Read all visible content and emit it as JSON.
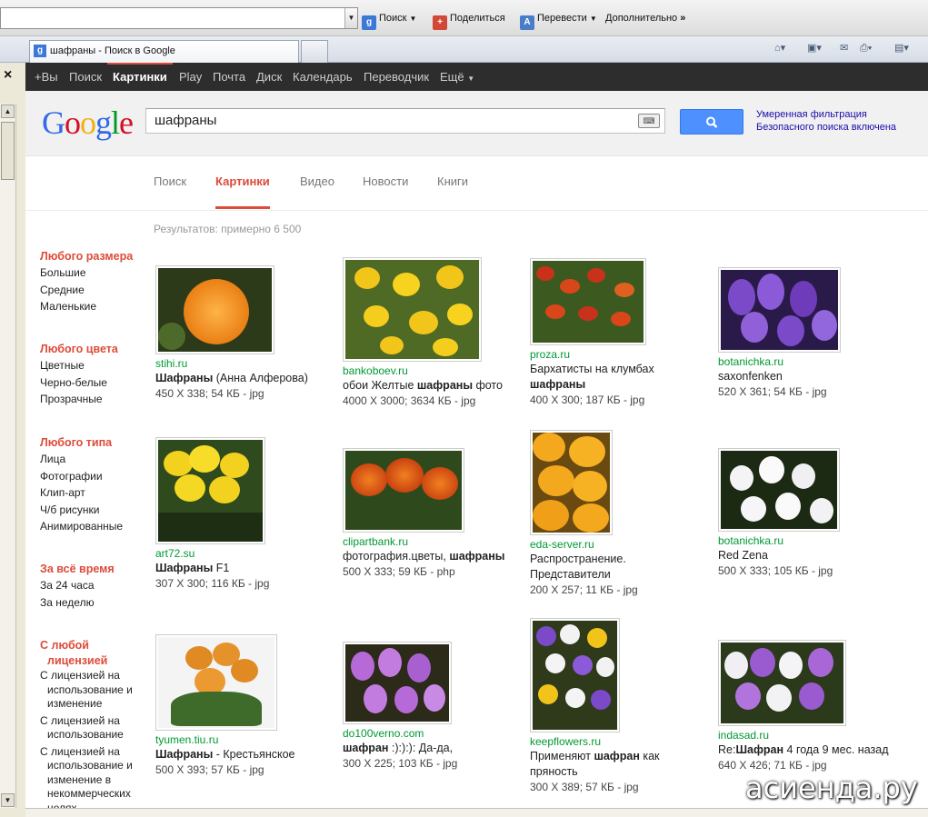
{
  "browser": {
    "toolbar": {
      "search_label": "Поиск",
      "share_label": "Поделиться",
      "translate_label": "Перевести",
      "more_label": "Дополнительно"
    },
    "tab_title": "шафраны - Поиск в Google"
  },
  "gbar": {
    "items": [
      "+Вы",
      "Поиск",
      "Картинки",
      "Play",
      "Почта",
      "Диск",
      "Календарь",
      "Переводчик",
      "Ещё"
    ]
  },
  "header": {
    "logo": [
      "G",
      "o",
      "o",
      "g",
      "l",
      "e"
    ],
    "query": "шафраны",
    "safe_line1": "Умеренная фильтрация",
    "safe_line2": "Безопасного поиска включена"
  },
  "tabs": [
    "Поиск",
    "Картинки",
    "Видео",
    "Новости",
    "Книги"
  ],
  "results_count": "Результатов: примерно 6 500",
  "filters": {
    "size": {
      "title": "Любого размера",
      "items": [
        "Большие",
        "Средние",
        "Маленькие"
      ]
    },
    "color": {
      "title": "Любого цвета",
      "items": [
        "Цветные",
        "Черно-белые",
        "Прозрачные"
      ]
    },
    "type": {
      "title": "Любого типа",
      "items": [
        "Лица",
        "Фотографии",
        "Клип-арт",
        "Ч/б рисунки",
        "Анимированные"
      ]
    },
    "time": {
      "title": "За всё время",
      "items": [
        "За 24 часа",
        "За неделю"
      ]
    },
    "license": {
      "title": "С любой лицензией",
      "items": [
        "С лицензией на использование и изменение",
        "С лицензией на использование",
        "С лицензией на использование и изменение в некоммерческих целях"
      ]
    }
  },
  "results": [
    {
      "domain": "stihi.ru",
      "title_bold": "Шафраны",
      "title_rest": " (Анна Алферова)",
      "meta": "450 X 338; 54 КБ - jpg"
    },
    {
      "domain": "bankoboev.ru",
      "title_pre": "обои Желтые ",
      "title_bold": "шафраны",
      "title_rest": " фото",
      "meta": "4000 X 3000; 3634 КБ - jpg"
    },
    {
      "domain": "proza.ru",
      "title_pre": "Бархатисты на клумбах ",
      "title_bold": "шафраны",
      "title_rest": "",
      "meta": "400 X 300; 187 КБ - jpg"
    },
    {
      "domain": "botanichka.ru",
      "title_pre": "saxonfenken",
      "meta": "520 X 361; 54 КБ - jpg"
    },
    {
      "domain": "art72.su",
      "title_bold": "Шафраны",
      "title_rest": " F1",
      "meta": "307 X 300; 116 КБ - jpg"
    },
    {
      "domain": "clipartbank.ru",
      "title_pre": "фотография.цветы, ",
      "title_bold": "шафраны",
      "title_rest": "",
      "meta": "500 X 333; 59 КБ - php"
    },
    {
      "domain": "eda-server.ru",
      "title_pre": "Распространение. Представители",
      "meta": "200 X 257; 11 КБ - jpg"
    },
    {
      "domain": "botanichka.ru",
      "title_pre": "Red Zena",
      "meta": "500 X 333; 105 КБ - jpg"
    },
    {
      "domain": "tyumen.tiu.ru",
      "title_bold": "Шафраны",
      "title_rest": " - Крестьянское",
      "meta": "500 X 393; 57 КБ - jpg"
    },
    {
      "domain": "do100verno.com",
      "title_bold": "шафран",
      "title_rest": " :):):): Да-да,",
      "meta": "300 X 225; 103 КБ - jpg"
    },
    {
      "domain": "keepflowers.ru",
      "title_pre": "Применяют ",
      "title_bold": "шафран",
      "title_rest": " как пряность",
      "meta": "300 X 389; 57 КБ - jpg"
    },
    {
      "domain": "indasad.ru",
      "title_pre": "Re:",
      "title_bold": "Шафран",
      "title_rest": " 4 года 9 мес. назад",
      "meta": "640 X 426; 71 КБ - jpg"
    }
  ],
  "watermark": "асиенда.ру",
  "colors": {
    "accent_red": "#dd4b39",
    "link_blue": "#1a0dab",
    "url_green": "#009933",
    "button_blue": "#4d90fe"
  }
}
